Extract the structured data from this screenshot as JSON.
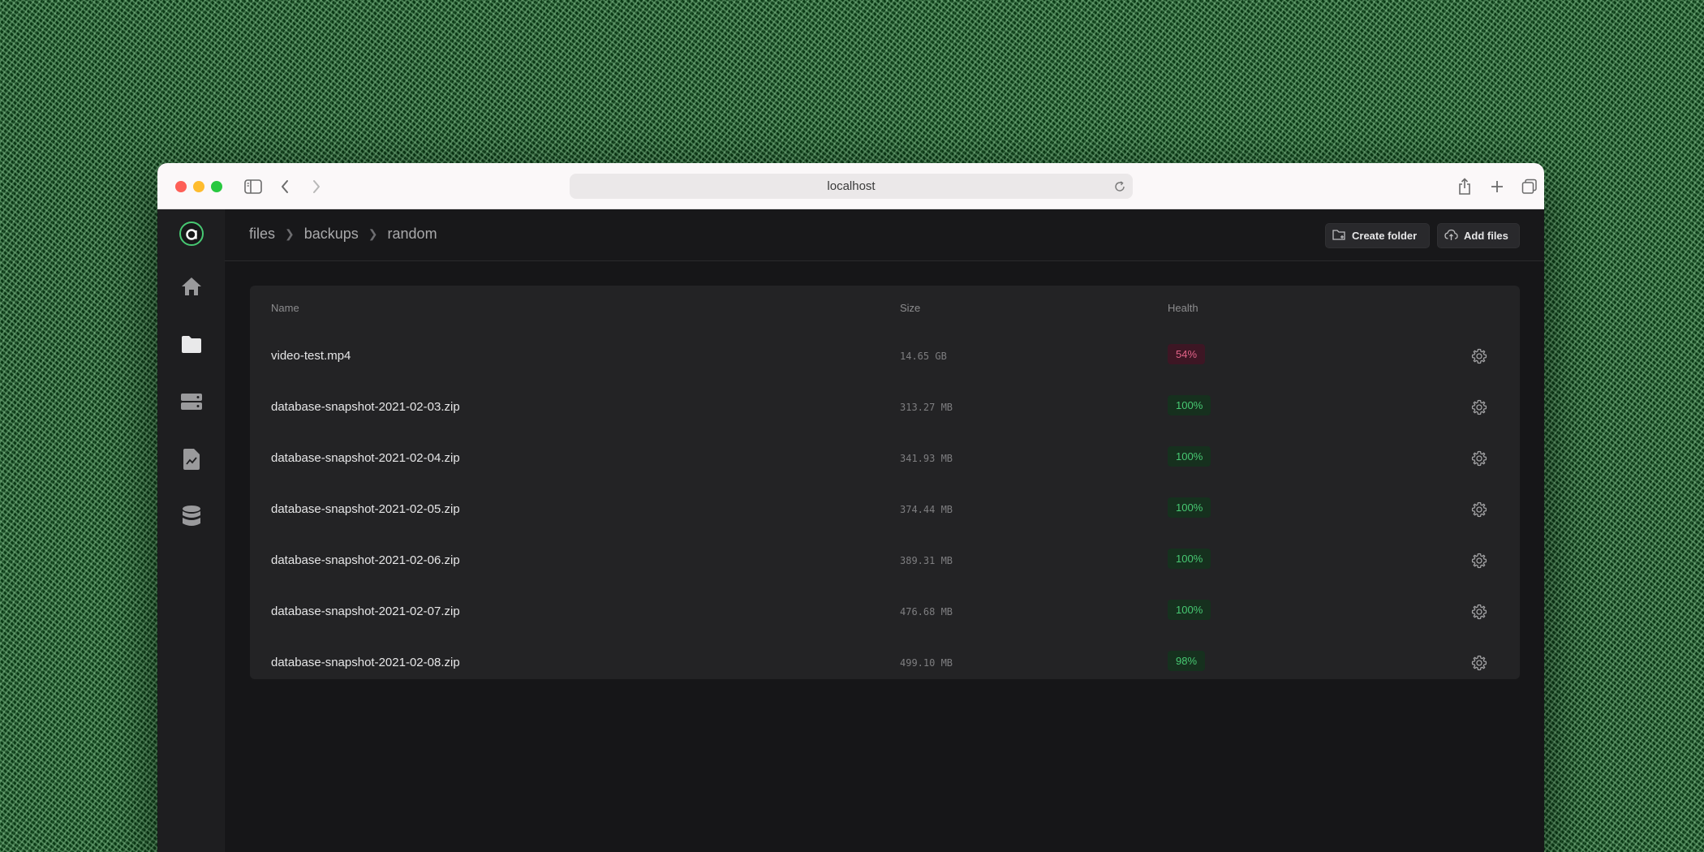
{
  "browser": {
    "url": "localhost"
  },
  "breadcrumb": [
    "files",
    "backups",
    "random"
  ],
  "actions": {
    "create_folder": "Create folder",
    "add_files": "Add files"
  },
  "table": {
    "headers": {
      "name": "Name",
      "size": "Size",
      "health": "Health"
    },
    "rows": [
      {
        "name": "video-test.mp4",
        "size": "14.65 GB",
        "health": "54%",
        "status": "bad"
      },
      {
        "name": "database-snapshot-2021-02-03.zip",
        "size": "313.27 MB",
        "health": "100%",
        "status": "good"
      },
      {
        "name": "database-snapshot-2021-02-04.zip",
        "size": "341.93 MB",
        "health": "100%",
        "status": "good"
      },
      {
        "name": "database-snapshot-2021-02-05.zip",
        "size": "374.44 MB",
        "health": "100%",
        "status": "good"
      },
      {
        "name": "database-snapshot-2021-02-06.zip",
        "size": "389.31 MB",
        "health": "100%",
        "status": "good"
      },
      {
        "name": "database-snapshot-2021-02-07.zip",
        "size": "476.68 MB",
        "health": "100%",
        "status": "good"
      },
      {
        "name": "database-snapshot-2021-02-08.zip",
        "size": "499.10 MB",
        "health": "98%",
        "status": "good"
      }
    ]
  },
  "colors": {
    "accent": "#47c872",
    "danger": "#e26388"
  },
  "sidebar": {
    "items": [
      "home-icon",
      "folder-icon",
      "server-icon",
      "document-chart-icon",
      "database-icon"
    ]
  }
}
